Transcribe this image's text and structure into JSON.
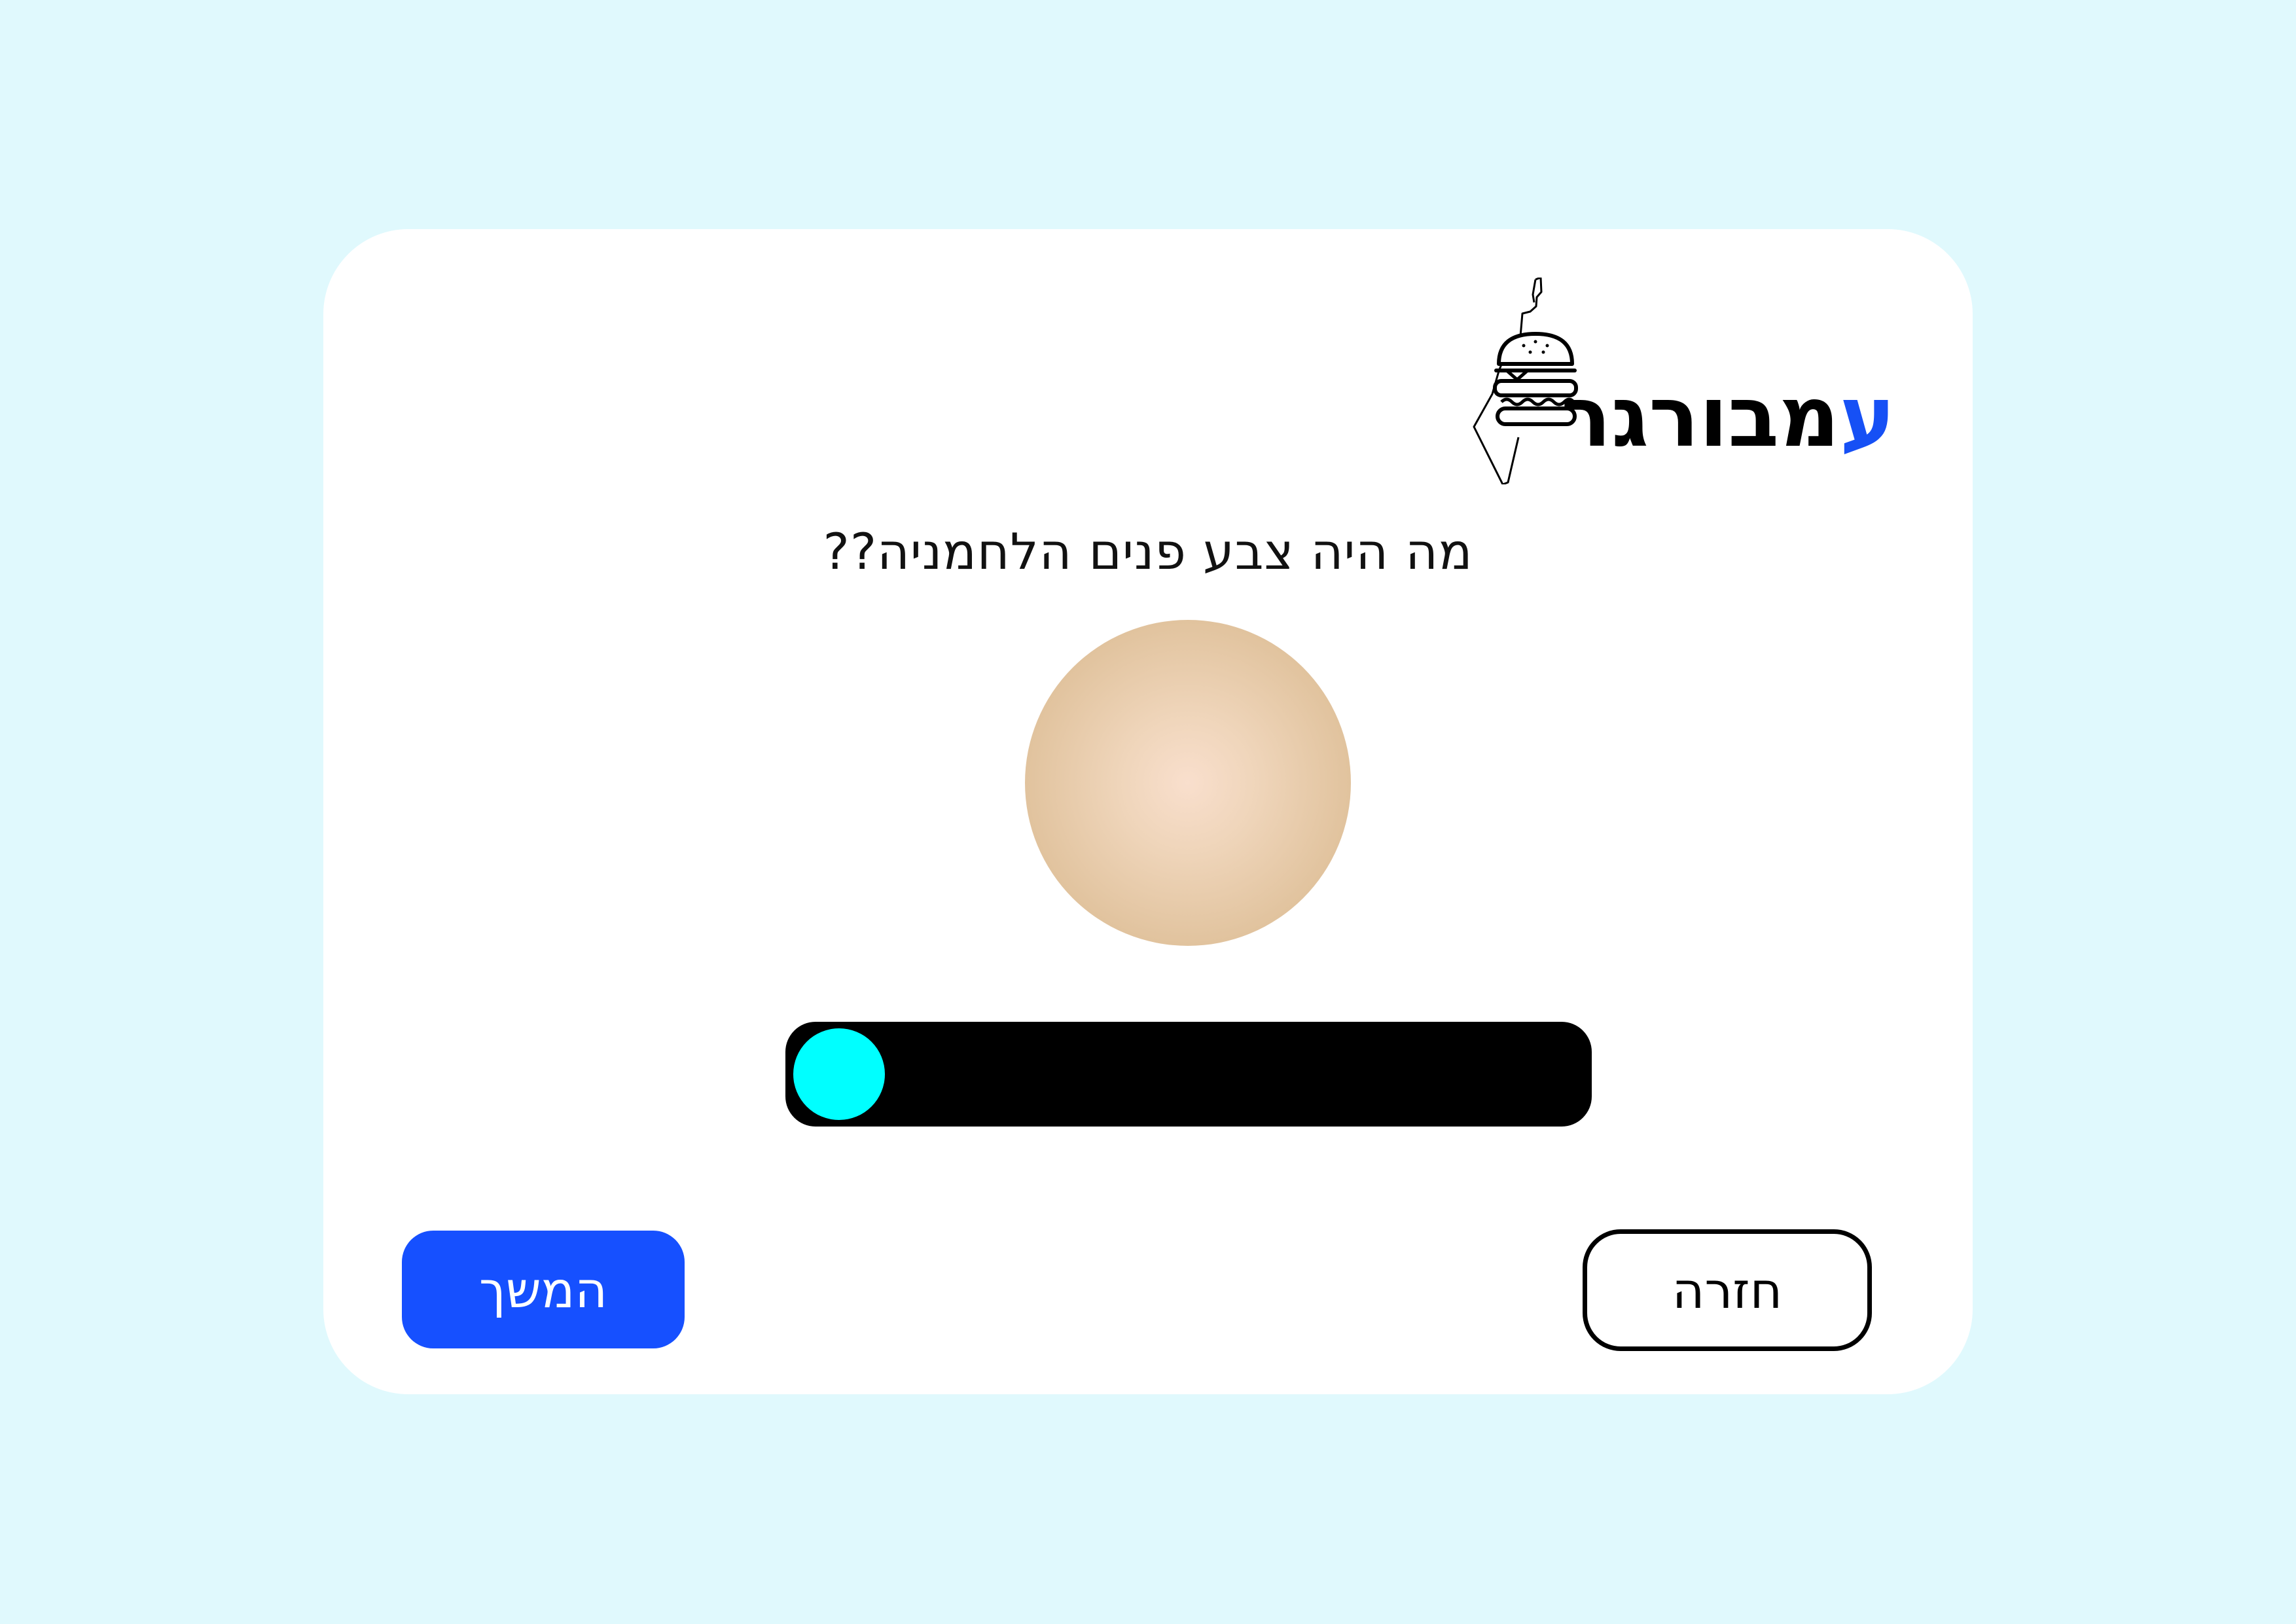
{
  "logo": {
    "first_letter": "ע",
    "rest": "מבורגר",
    "icon": "israel-map-burger-icon",
    "accent_color": "#1650f5"
  },
  "question": "מה היה צבע פנים הלחמניה??",
  "color_preview": {
    "color_center": "#f9dfcd",
    "color_edge": "#d9bb94"
  },
  "slider": {
    "value": 0,
    "track_color": "#000000",
    "thumb_color": "#00ffff"
  },
  "buttons": {
    "continue_label": "המשך",
    "back_label": "חזרה",
    "continue_color": "#1650ff"
  },
  "colors": {
    "page_background": "#e0f9fd",
    "card_background": "#ffffff"
  }
}
